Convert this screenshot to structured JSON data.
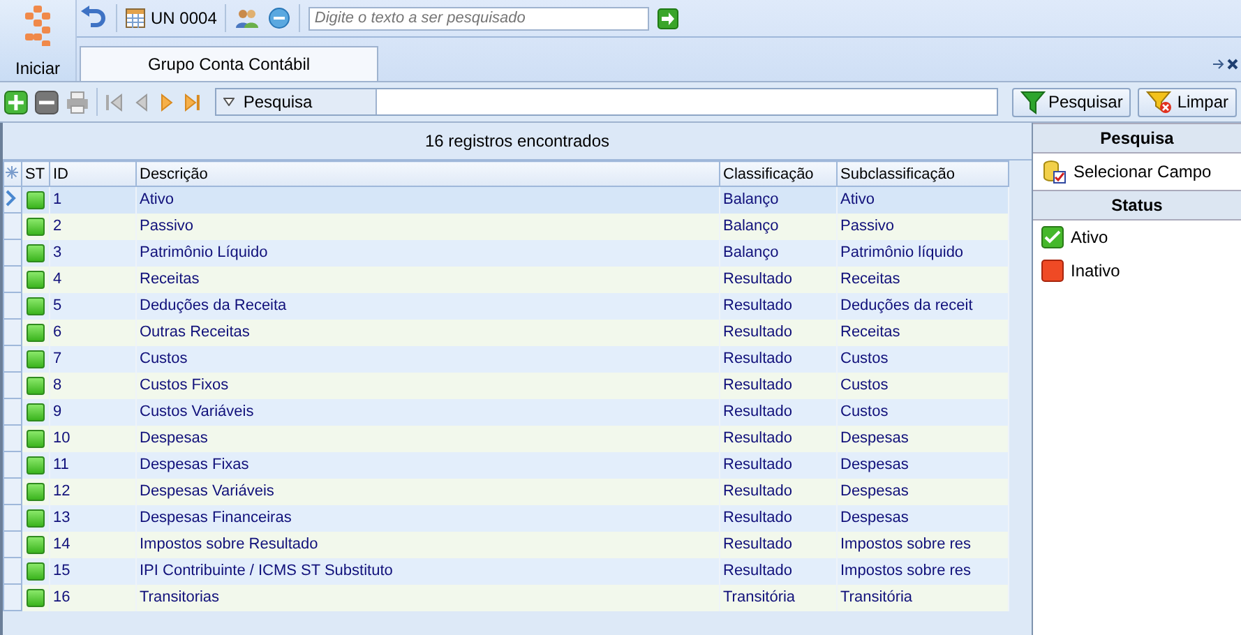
{
  "ribbon": {
    "start_label": "Iniciar",
    "unit": "UN 0004",
    "search": {
      "placeholder": "Digite o texto a ser pesquisado"
    }
  },
  "tabs": [
    {
      "label": "Grupo Conta Contábil",
      "selected": true
    }
  ],
  "toolbar": {
    "filter_label": "Pesquisa",
    "buttons": [
      {
        "label": "Pesquisar",
        "kind": "search"
      },
      {
        "label": "Limpar",
        "kind": "clear"
      }
    ]
  },
  "grid": {
    "summary": "16 registros encontrados",
    "columns": [
      "ST",
      "ID",
      "Descrição",
      "Classificação",
      "Subclassificação"
    ],
    "rows": [
      {
        "selected": true,
        "active": true,
        "id": "1",
        "descricao": "Ativo",
        "classificacao": "Balanço",
        "sub": "Ativo"
      },
      {
        "selected": false,
        "active": true,
        "id": "2",
        "descricao": "Passivo",
        "classificacao": "Balanço",
        "sub": "Passivo"
      },
      {
        "selected": false,
        "active": true,
        "id": "3",
        "descricao": "Patrimônio Líquido",
        "classificacao": "Balanço",
        "sub": "Patrimônio líquido"
      },
      {
        "selected": false,
        "active": true,
        "id": "4",
        "descricao": "Receitas",
        "classificacao": "Resultado",
        "sub": "Receitas"
      },
      {
        "selected": false,
        "active": true,
        "id": "5",
        "descricao": "Deduções da Receita",
        "classificacao": "Resultado",
        "sub": "Deduções da receit"
      },
      {
        "selected": false,
        "active": true,
        "id": "6",
        "descricao": "Outras Receitas",
        "classificacao": "Resultado",
        "sub": "Receitas"
      },
      {
        "selected": false,
        "active": true,
        "id": "7",
        "descricao": "Custos",
        "classificacao": "Resultado",
        "sub": "Custos"
      },
      {
        "selected": false,
        "active": true,
        "id": "8",
        "descricao": "Custos Fixos",
        "classificacao": "Resultado",
        "sub": "Custos"
      },
      {
        "selected": false,
        "active": true,
        "id": "9",
        "descricao": "Custos Variáveis",
        "classificacao": "Resultado",
        "sub": "Custos"
      },
      {
        "selected": false,
        "active": true,
        "id": "10",
        "descricao": "Despesas",
        "classificacao": "Resultado",
        "sub": "Despesas"
      },
      {
        "selected": false,
        "active": true,
        "id": "11",
        "descricao": "Despesas Fixas",
        "classificacao": "Resultado",
        "sub": "Despesas"
      },
      {
        "selected": false,
        "active": true,
        "id": "12",
        "descricao": "Despesas Variáveis",
        "classificacao": "Resultado",
        "sub": "Despesas"
      },
      {
        "selected": false,
        "active": true,
        "id": "13",
        "descricao": "Despesas Financeiras",
        "classificacao": "Resultado",
        "sub": "Despesas"
      },
      {
        "selected": false,
        "active": true,
        "id": "14",
        "descricao": "Impostos sobre Resultado",
        "classificacao": "Resultado",
        "sub": "Impostos sobre res"
      },
      {
        "selected": false,
        "active": true,
        "id": "15",
        "descricao": "IPI Contribuinte / ICMS ST Substituto",
        "classificacao": "Resultado",
        "sub": "Impostos sobre res"
      },
      {
        "selected": false,
        "active": true,
        "id": "16",
        "descricao": "Transitorias",
        "classificacao": "Transitória",
        "sub": "Transitória"
      }
    ]
  },
  "side_panel": {
    "sections": [
      {
        "title": "Pesquisa",
        "items": [
          {
            "label": "Selecionar Campo",
            "kind": "field"
          }
        ]
      },
      {
        "title": "Status",
        "items": [
          {
            "label": "Ativo",
            "kind": "active"
          },
          {
            "label": "Inativo",
            "kind": "inactive"
          }
        ]
      }
    ]
  }
}
